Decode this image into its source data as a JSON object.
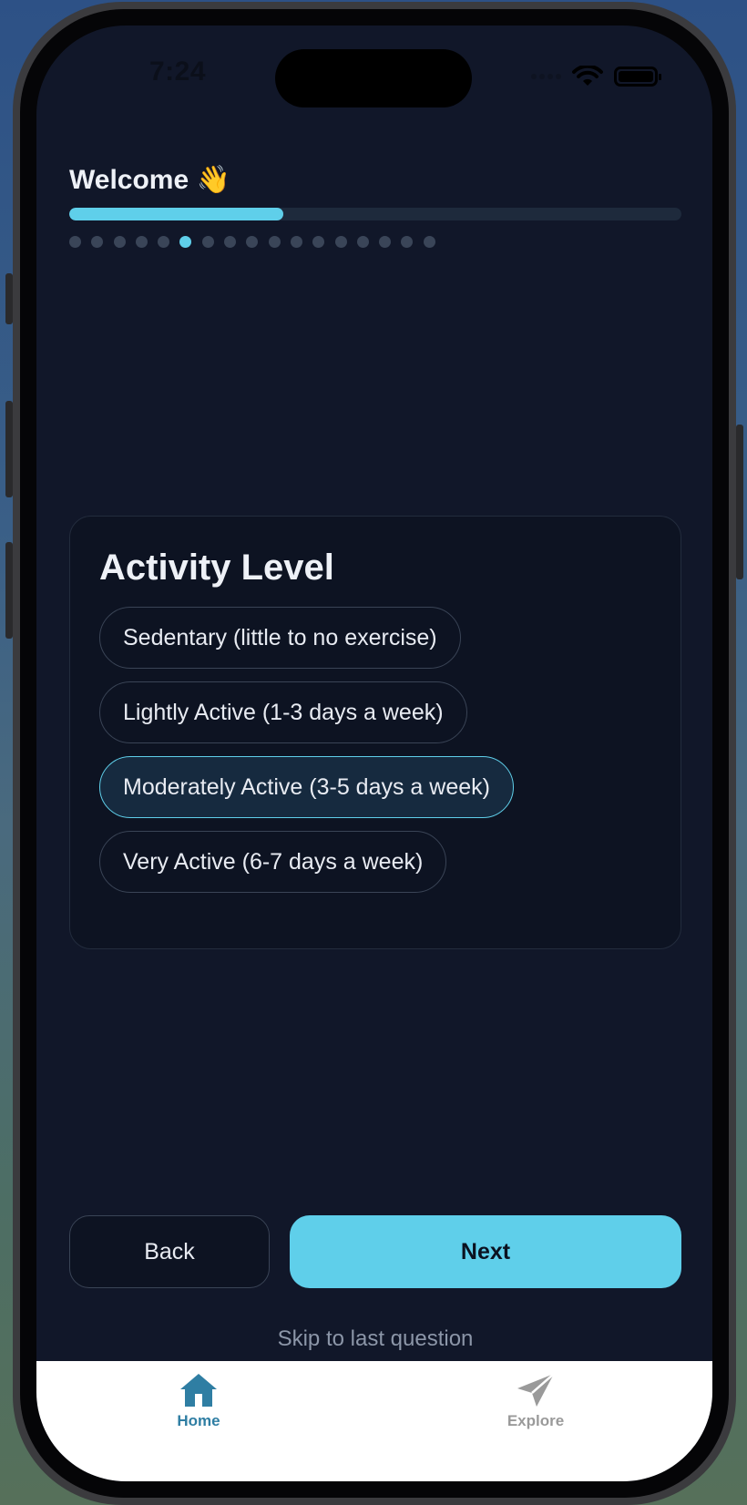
{
  "status_bar": {
    "time": "7:24"
  },
  "header": {
    "title": "Welcome",
    "title_emoji": "👋",
    "progress": 0.35,
    "step_count": 17,
    "current_step": 6
  },
  "question": {
    "title": "Activity Level",
    "options": [
      {
        "label": "Sedentary (little to no exercise)",
        "selected": false
      },
      {
        "label": "Lightly Active (1-3 days a week)",
        "selected": false
      },
      {
        "label": "Moderately Active (3-5 days a week)",
        "selected": true
      },
      {
        "label": "Very Active (6-7 days a week)",
        "selected": false
      }
    ]
  },
  "navigation": {
    "back_label": "Back",
    "next_label": "Next",
    "skip_label": "Skip to last question"
  },
  "tabbar": {
    "items": [
      {
        "label": "Home",
        "icon": "home-icon",
        "active": true
      },
      {
        "label": "Explore",
        "icon": "send-icon",
        "active": false
      }
    ]
  },
  "colors": {
    "accent": "#5fcfea",
    "background": "#111729",
    "card": "#0d1322",
    "tab_active": "#2f7ea3",
    "tab_inactive": "#9a9a9a"
  }
}
